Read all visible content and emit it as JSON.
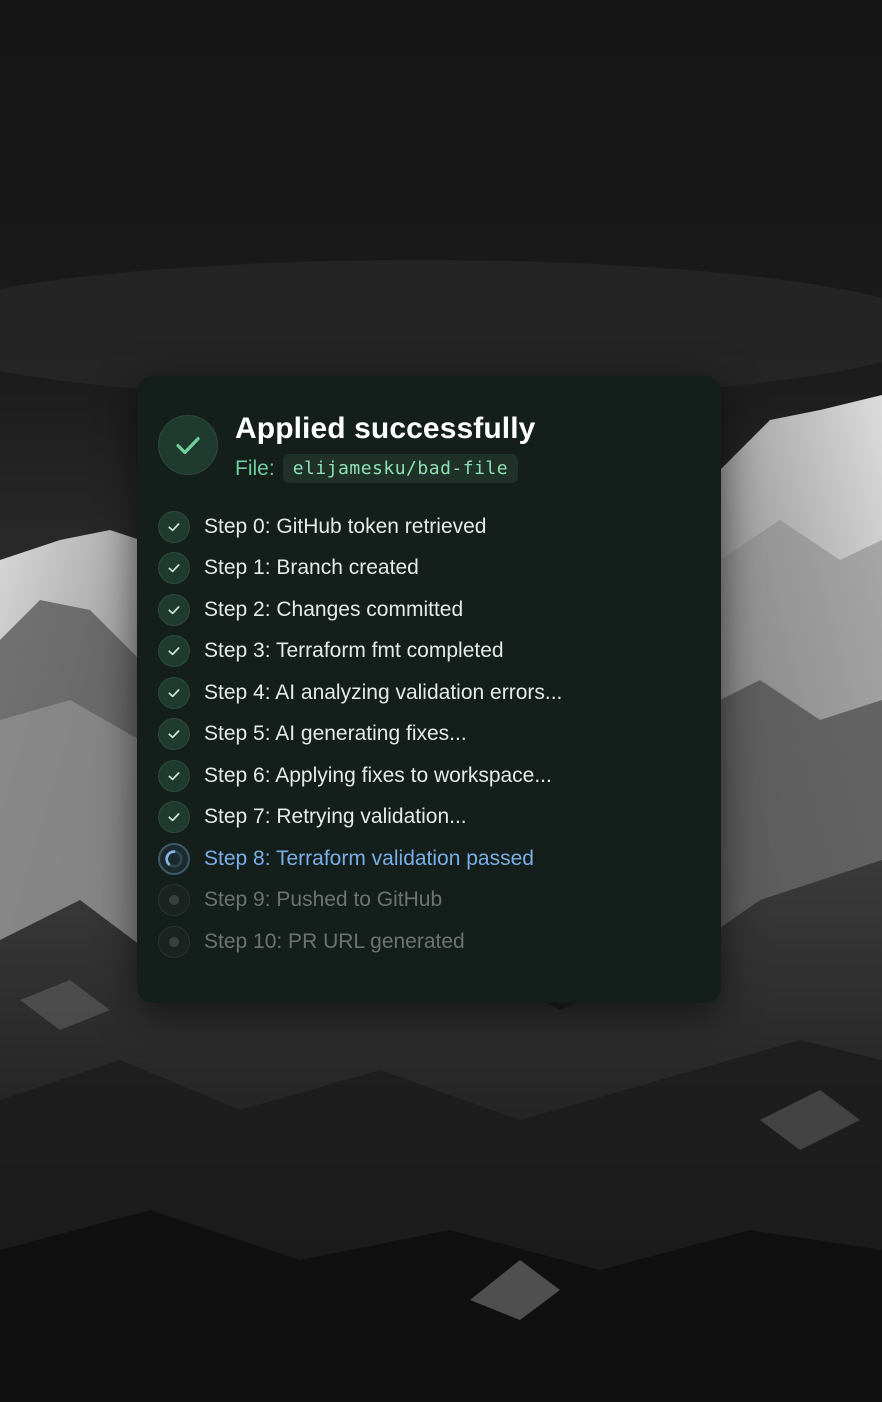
{
  "card": {
    "title": "Applied successfully",
    "file_label": "File:",
    "file_value": "elijamesku/bad-file",
    "status_icon": "check-icon"
  },
  "steps": [
    {
      "label": "Step 0: GitHub token retrieved",
      "status": "done"
    },
    {
      "label": "Step 1: Branch created",
      "status": "done"
    },
    {
      "label": "Step 2: Changes committed",
      "status": "done"
    },
    {
      "label": "Step 3: Terraform fmt completed",
      "status": "done"
    },
    {
      "label": "Step 4: AI analyzing validation errors...",
      "status": "done"
    },
    {
      "label": "Step 5: AI generating fixes...",
      "status": "done"
    },
    {
      "label": "Step 6: Applying fixes to workspace...",
      "status": "done"
    },
    {
      "label": "Step 7: Retrying validation...",
      "status": "done"
    },
    {
      "label": "Step 8: Terraform validation passed",
      "status": "active"
    },
    {
      "label": "Step 9: Pushed to GitHub",
      "status": "pending"
    },
    {
      "label": "Step 10: PR URL generated",
      "status": "pending"
    }
  ],
  "colors": {
    "card_background": "#141e1a",
    "success_green": "#6fcf9c",
    "active_blue": "#7aaee8",
    "pending_gray": "#6c7370"
  }
}
